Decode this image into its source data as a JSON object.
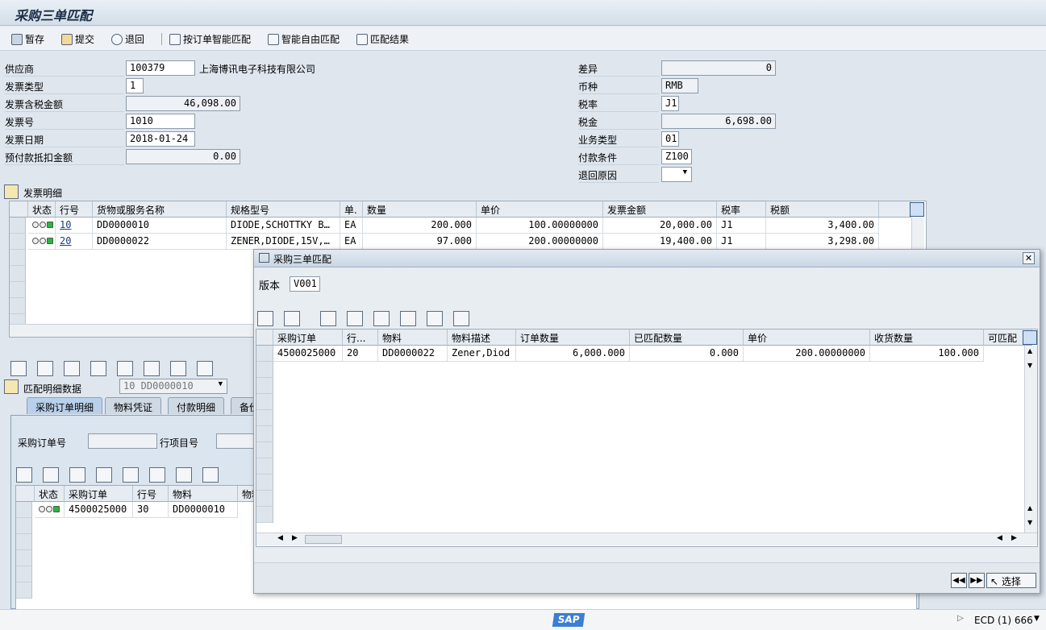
{
  "window": {
    "title": "采购三单匹配"
  },
  "toolbar": {
    "save": "暂存",
    "submit": "提交",
    "back": "退回",
    "po_smart_match": "按订单智能匹配",
    "smart_free_match": "智能自由匹配",
    "match_result": "匹配结果"
  },
  "header_left": {
    "vendor_label": "供应商",
    "vendor_value": "100379",
    "vendor_name": "上海博讯电子科技有限公司",
    "invoice_type_label": "发票类型",
    "invoice_type_value": "1",
    "amount_label": "发票含税金额",
    "amount_value": "46,098.00",
    "invoice_no_label": "发票号",
    "invoice_no_value": "1010",
    "invoice_date_label": "发票日期",
    "invoice_date_value": "2018-01-24",
    "prepay_label": "预付款抵扣金额",
    "prepay_value": "0.00"
  },
  "header_right": {
    "diff_label": "差异",
    "diff_value": "0",
    "currency_label": "币种",
    "currency_value": "RMB",
    "tax_code_label": "税率",
    "tax_code_value": "J1",
    "tax_label": "税金",
    "tax_value": "6,698.00",
    "biz_type_label": "业务类型",
    "biz_type_value": "01",
    "payment_label": "付款条件",
    "payment_value": "Z100",
    "return_reason_label": "退回原因",
    "return_reason_value": ""
  },
  "invoice_details": {
    "title": "发票明细",
    "columns": [
      "状态",
      "行号",
      "货物或服务名称",
      "规格型号",
      "单.",
      "数量",
      "单价",
      "发票金额",
      "税率",
      "税额"
    ],
    "rows": [
      {
        "line": "10",
        "item": "DD0000010",
        "spec": "DIODE,SCHOTTKY B…",
        "unit": "EA",
        "qty": "200.000",
        "price": "100.00000000",
        "amount": "20,000.00",
        "tax_code": "J1",
        "tax": "3,400.00"
      },
      {
        "line": "20",
        "item": "DD0000022",
        "spec": "ZENER,DIODE,15V,…",
        "unit": "EA",
        "qty": "97.000",
        "price": "200.00000000",
        "amount": "19,400.00",
        "tax_code": "J1",
        "tax": "3,298.00"
      }
    ]
  },
  "match_detail": {
    "title": "匹配明细数据",
    "dropdown_value": "10 DD0000010",
    "tabs": [
      "采购订单明细",
      "物料凭证",
      "付款明细",
      "备份"
    ],
    "po_label": "采购订单号",
    "po_item_label": "行项目号",
    "columns": [
      "状态",
      "采购订单",
      "行号",
      "物料",
      "物料"
    ],
    "rows": [
      {
        "po": "4500025000",
        "line": "30",
        "material": "DD0000010"
      }
    ]
  },
  "dialog": {
    "title": "采购三单匹配",
    "version_label": "版本",
    "version_value": "V001",
    "columns": [
      "采购订单",
      "行...",
      "物料",
      "物料描述",
      "订单数量",
      "已匹配数量",
      "单价",
      "收货数量",
      "可匹配"
    ],
    "rows": [
      {
        "po": "4500025000",
        "line": "20",
        "material": "DD0000022",
        "desc": "Zener,Diod",
        "order_qty": "6,000.000",
        "matched_qty": "0.000",
        "price": "200.00000000",
        "gr_qty": "100.000"
      }
    ],
    "select_label": "选择"
  },
  "status": {
    "sap_logo": "SAP",
    "system": "ECD (1) 666"
  }
}
